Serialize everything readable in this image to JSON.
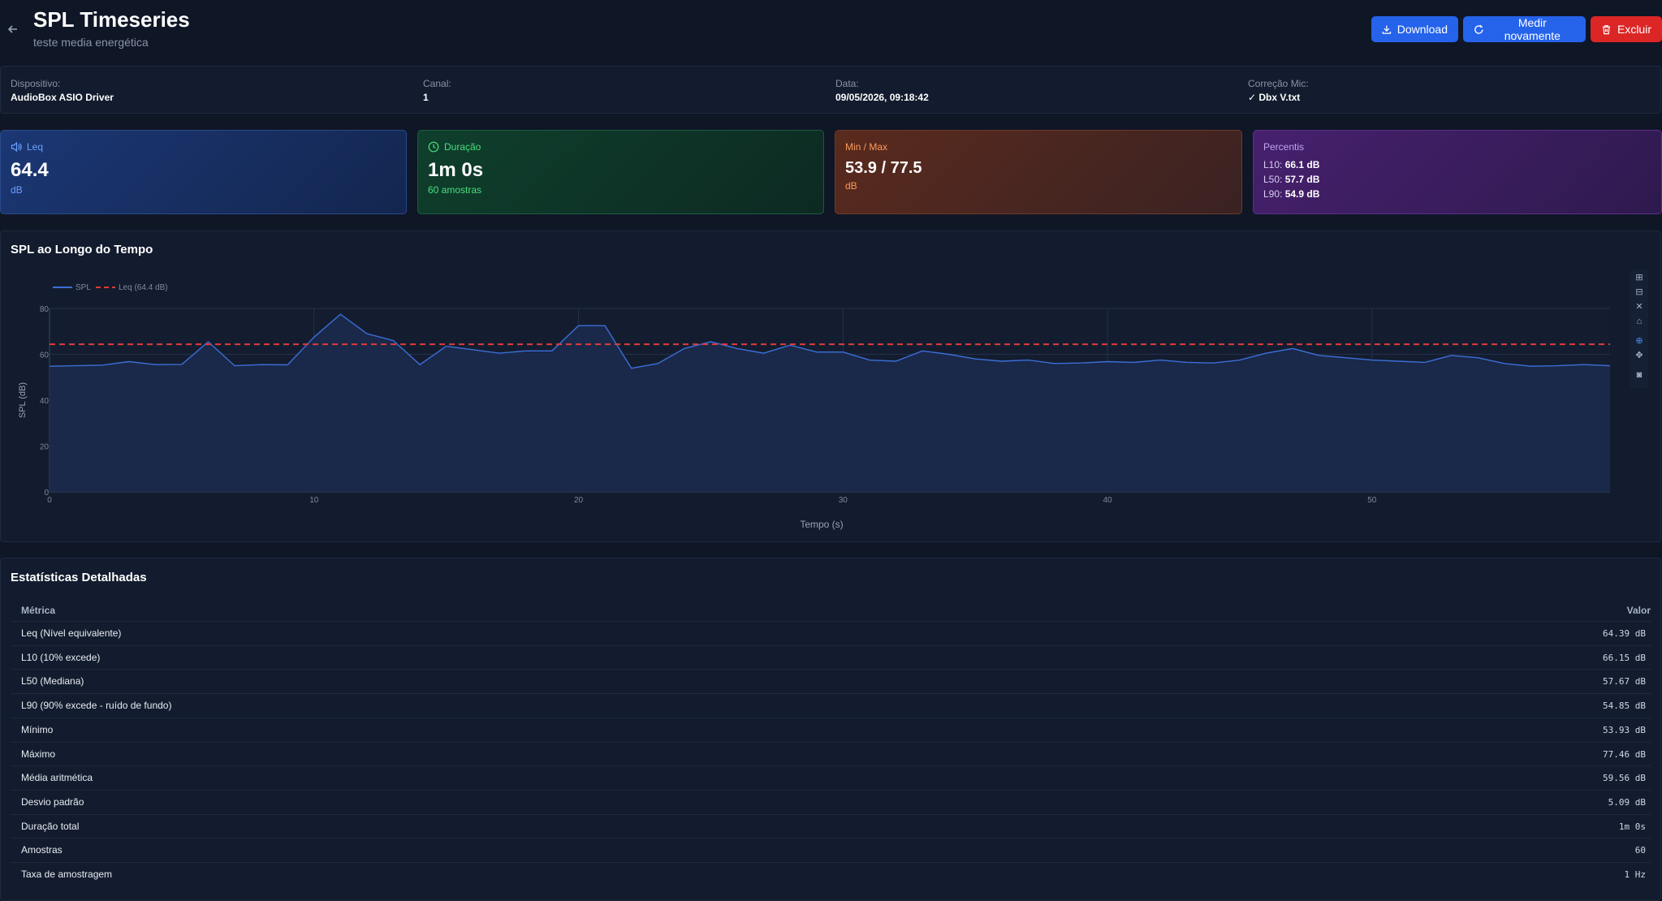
{
  "header": {
    "title": "SPL Timeseries",
    "subtitle": "teste media energética",
    "buttons": {
      "download": "Download",
      "measure": "Medir novamente",
      "delete": "Excluir"
    }
  },
  "info": {
    "device_label": "Dispositivo:",
    "device_value": "AudioBox ASIO Driver",
    "channel_label": "Canal:",
    "channel_value": "1",
    "date_label": "Data:",
    "date_value": "09/05/2026, 09:18:42",
    "mic_label": "Correção Mic:",
    "mic_value": "✓ Dbx V.txt"
  },
  "cards": {
    "leq": {
      "label": "Leq",
      "value": "64.4",
      "unit": "dB"
    },
    "duration": {
      "label": "Duração",
      "value": "1m 0s",
      "sub": "60 amostras"
    },
    "minmax": {
      "label": "Min / Max",
      "value": "53.9 / 77.5",
      "unit": "dB"
    },
    "percentis": {
      "label": "Percentis",
      "rows": [
        {
          "key": "L10:",
          "val": "66.1 dB"
        },
        {
          "key": "L50:",
          "val": "57.7 dB"
        },
        {
          "key": "L90:",
          "val": "54.9 dB"
        }
      ]
    }
  },
  "chart_section": {
    "title": "SPL ao Longo do Tempo"
  },
  "chart_data": {
    "type": "line",
    "title": "",
    "xlabel": "Tempo (s)",
    "ylabel": "SPL (dB)",
    "xlim": [
      0,
      59
    ],
    "ylim": [
      0,
      80
    ],
    "xticks": [
      0,
      10,
      20,
      30,
      40,
      50
    ],
    "yticks": [
      0,
      20,
      40,
      60,
      80
    ],
    "grid": true,
    "legend_position": "top-left",
    "series": [
      {
        "name": "SPL",
        "color": "#3b6fd8",
        "fill": "#1b2a4d",
        "x": [
          0,
          1,
          2,
          3,
          4,
          5,
          6,
          7,
          8,
          9,
          10,
          11,
          12,
          13,
          14,
          15,
          16,
          17,
          18,
          19,
          20,
          21,
          22,
          23,
          24,
          25,
          26,
          27,
          28,
          29,
          30,
          31,
          32,
          33,
          34,
          35,
          36,
          37,
          38,
          39,
          40,
          41,
          42,
          43,
          44,
          45,
          46,
          47,
          48,
          49,
          50,
          51,
          52,
          53,
          54,
          55,
          56,
          57,
          58,
          59
        ],
        "y": [
          54.8,
          55.0,
          55.3,
          56.8,
          55.5,
          55.6,
          65.5,
          55.0,
          55.5,
          55.4,
          67.5,
          77.5,
          69.0,
          66.0,
          55.5,
          63.5,
          62.0,
          60.5,
          61.5,
          61.5,
          72.5,
          72.5,
          53.9,
          56.0,
          62.5,
          65.5,
          62.5,
          60.5,
          64.0,
          61.0,
          61.0,
          57.5,
          57.0,
          61.5,
          60.0,
          58.0,
          57.0,
          57.5,
          56.0,
          56.2,
          56.8,
          56.5,
          57.5,
          56.5,
          56.2,
          57.5,
          60.5,
          62.5,
          59.5,
          58.5,
          57.5,
          57.0,
          56.5,
          59.5,
          58.5,
          56.0,
          54.8,
          55.0,
          55.5,
          55.0
        ]
      },
      {
        "name": "Leq (64.4 dB)",
        "color": "#e03a3a",
        "dash": true,
        "x": [
          0,
          59
        ],
        "y": [
          64.4,
          64.4
        ]
      }
    ]
  },
  "stats": {
    "title": "Estatísticas Detalhadas",
    "col_metric": "Métrica",
    "col_value": "Valor",
    "rows": [
      {
        "metric": "Leq (Nível equivalente)",
        "value": "64.39 dB"
      },
      {
        "metric": "L10 (10% excede)",
        "value": "66.15 dB"
      },
      {
        "metric": "L50 (Mediana)",
        "value": "57.67 dB"
      },
      {
        "metric": "L90 (90% excede - ruído de fundo)",
        "value": "54.85 dB"
      },
      {
        "metric": "Mínimo",
        "value": "53.93 dB"
      },
      {
        "metric": "Máximo",
        "value": "77.46 dB"
      },
      {
        "metric": "Média aritmética",
        "value": "59.56 dB"
      },
      {
        "metric": "Desvio padrão",
        "value": "5.09 dB"
      },
      {
        "metric": "Duração total",
        "value": "1m 0s"
      },
      {
        "metric": "Amostras",
        "value": "60"
      },
      {
        "metric": "Taxa de amostragem",
        "value": "1 Hz"
      }
    ]
  },
  "colors": {
    "background": "#0f1626",
    "primary": "#2563eb",
    "danger": "#dc2626",
    "leq_accent": "#6aa0ff",
    "duration_accent": "#4ade80",
    "minmax_accent": "#fb9a5a",
    "percentis_accent": "#c4a2f5"
  },
  "icons": {
    "back": "arrow-left-icon",
    "download": "download-icon",
    "measure": "refresh-icon",
    "delete": "trash-icon",
    "leq": "speaker-icon",
    "duration": "clock-icon"
  }
}
